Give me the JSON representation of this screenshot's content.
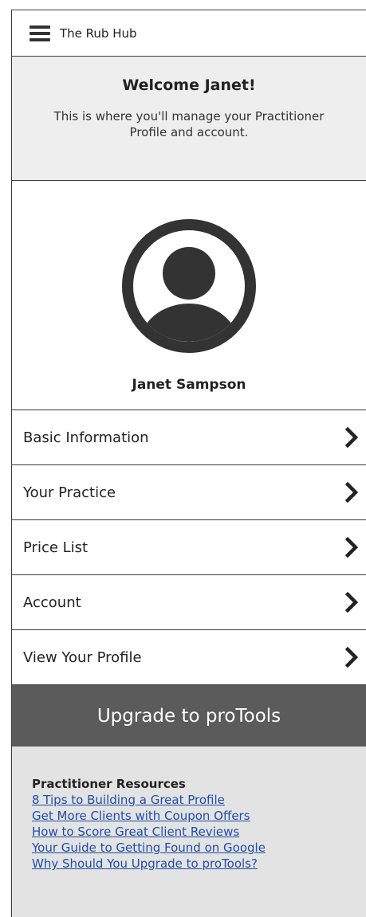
{
  "header": {
    "menu_icon": "hamburger-icon",
    "title": "The Rub Hub"
  },
  "welcome": {
    "heading": "Welcome Janet!",
    "message": "This is where you'll manage your Practitioner Profile and account."
  },
  "profile": {
    "avatar_icon": "user-avatar-icon",
    "name": "Janet Sampson"
  },
  "menu": {
    "items": [
      {
        "label": "Basic Information",
        "icon": "chevron-right-icon"
      },
      {
        "label": "Your Practice",
        "icon": "chevron-right-icon"
      },
      {
        "label": "Price List",
        "icon": "chevron-right-icon"
      },
      {
        "label": "Account",
        "icon": "chevron-right-icon"
      },
      {
        "label": "View Your Profile",
        "icon": "chevron-right-icon"
      }
    ]
  },
  "upgrade": {
    "label": "Upgrade to proTools",
    "background": "#5b5b5b"
  },
  "resources": {
    "heading": "Practitioner Resources",
    "links": [
      "8 Tips to Building a Great Profile",
      "Get More Clients with Coupon Offers",
      "How to Score Great Client Reviews",
      "Your Guide to Getting Found on Google",
      "Why Should You Upgrade to proTools?"
    ],
    "link_color": "#1f4ea8"
  }
}
